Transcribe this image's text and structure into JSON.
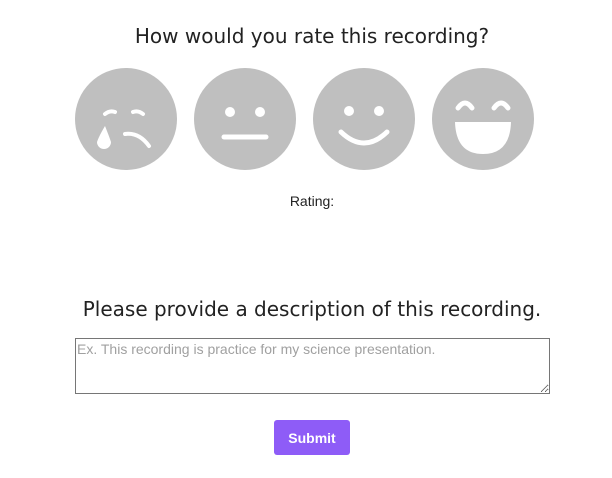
{
  "rating_prompt": "How would you rate this recording?",
  "faces": [
    {
      "icon": "crying-face-icon"
    },
    {
      "icon": "neutral-face-icon"
    },
    {
      "icon": "smiling-face-icon"
    },
    {
      "icon": "grinning-face-icon"
    }
  ],
  "rating_label": "Rating:",
  "description_heading": "Please provide a description of this recording.",
  "description_input": {
    "value": "",
    "placeholder": "Ex. This recording is practice for my science presentation."
  },
  "submit_label": "Submit",
  "colors": {
    "face_fill": "#bfbfbf",
    "face_features": "#ffffff",
    "accent": "#8e5cf7"
  }
}
